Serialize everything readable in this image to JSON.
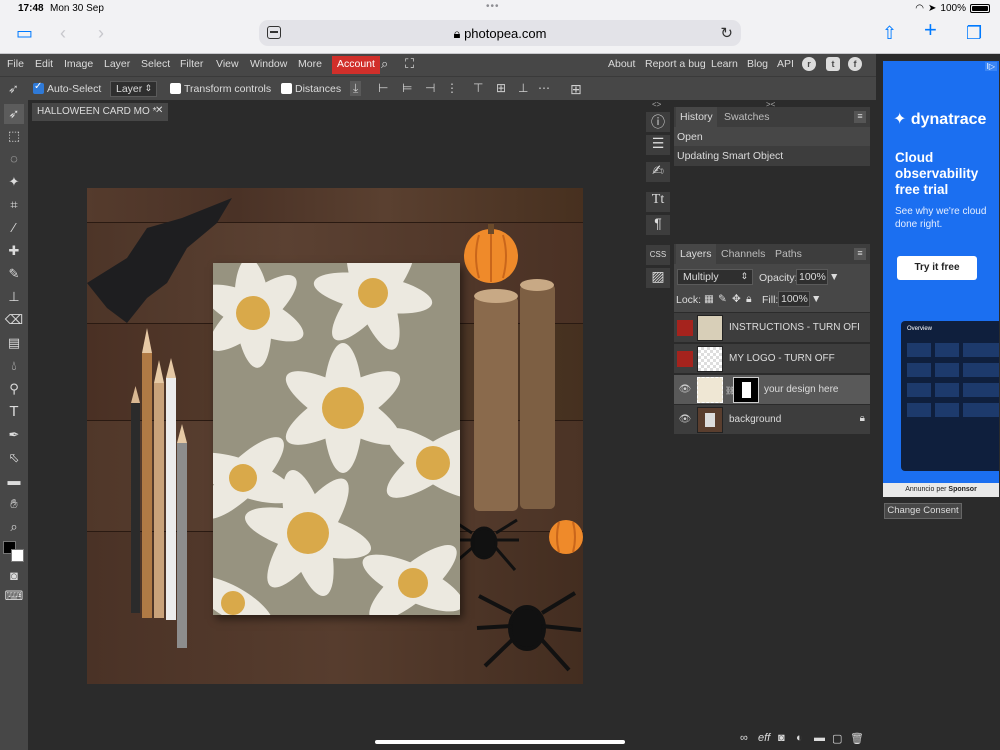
{
  "status": {
    "time": "17:48",
    "date": "Mon 30 Sep",
    "battery": "100%",
    "dots": "•••"
  },
  "safari": {
    "url": "photopea.com"
  },
  "menu": {
    "items": [
      "File",
      "Edit",
      "Image",
      "Layer",
      "Select",
      "Filter",
      "View",
      "Window",
      "More"
    ],
    "account": "Account",
    "right": [
      "About",
      "Report a bug",
      "Learn",
      "Blog",
      "API"
    ],
    "social": [
      "reddit-icon",
      "twitter-icon",
      "facebook-icon"
    ]
  },
  "options": {
    "auto_select": "Auto-Select",
    "auto_select_checked": true,
    "layer_select": "Layer",
    "transform_controls": "Transform controls",
    "distances": "Distances"
  },
  "document": {
    "tab_title": "HALLOWEEN CARD MO *"
  },
  "history": {
    "tabs": [
      "History",
      "Swatches"
    ],
    "rows": [
      "Open",
      "Updating Smart Object"
    ]
  },
  "layers": {
    "tabs": [
      "Layers",
      "Channels",
      "Paths"
    ],
    "blend_mode": "Multiply",
    "opacity_label": "Opacity:",
    "opacity": "100%",
    "lock_label": "Lock:",
    "fill_label": "Fill:",
    "fill": "100%",
    "rows": [
      {
        "name": "INSTRUCTIONS - TURN OFI",
        "visible": false,
        "selected": false,
        "locked": false
      },
      {
        "name": "MY LOGO - TURN OFF",
        "visible": false,
        "selected": false,
        "locked": false
      },
      {
        "name": "your design here",
        "visible": true,
        "selected": true,
        "locked": false
      },
      {
        "name": "background",
        "visible": true,
        "selected": false,
        "locked": true
      }
    ]
  },
  "ad": {
    "brand": "dynatrace",
    "headline": "Cloud observability free trial",
    "sub": "See why we're cloud done right.",
    "cta": "Try it free",
    "preview_title": "Overview",
    "footer_prefix": "Annuncio per",
    "footer_sponsor": "Sponsor",
    "consent": "Change Consent",
    "badge": "I▷"
  },
  "colors": {
    "accent_red": "#d12f2a",
    "ad_blue": "#1b6ff1",
    "panel_dark": "#2b2b2b",
    "panel_mid": "#474747"
  }
}
